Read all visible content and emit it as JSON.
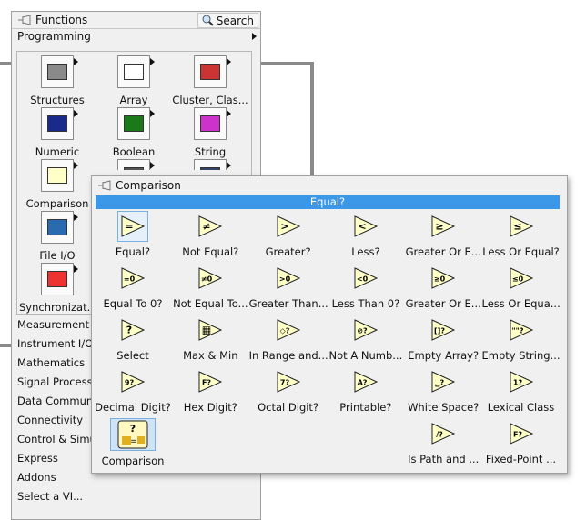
{
  "functions_palette": {
    "title": "Functions",
    "search_label": "Search",
    "programming_label": "Programming",
    "subpalettes": [
      {
        "label": "Structures",
        "icon": "structures-icon"
      },
      {
        "label": "Array",
        "icon": "array-icon"
      },
      {
        "label": "Cluster, Clas...",
        "icon": "cluster-icon"
      },
      {
        "label": "Numeric",
        "icon": "numeric-icon"
      },
      {
        "label": "Boolean",
        "icon": "boolean-icon"
      },
      {
        "label": "String",
        "icon": "string-icon"
      },
      {
        "label": "Comparison",
        "icon": "comparison-icon"
      },
      {
        "label": "",
        "icon": "timing-icon"
      },
      {
        "label": "",
        "icon": "dialog-icon"
      },
      {
        "label": "File I/O",
        "icon": "file-io-icon"
      },
      {
        "label": "",
        "icon": ""
      },
      {
        "label": "",
        "icon": ""
      },
      {
        "label": "Synchronizat...",
        "icon": "synchronization-icon"
      }
    ],
    "categories": [
      "Measurement I",
      "Instrument I/O",
      "Mathematics",
      "Signal Processi",
      "Data Communi",
      "Connectivity",
      "Control & Simu",
      "Express",
      "Addons",
      "Select a VI..."
    ]
  },
  "comparison_palette": {
    "title": "Comparison",
    "highlighted": "Equal?",
    "items": [
      {
        "label": "Equal?",
        "glyph": "="
      },
      {
        "label": "Not Equal?",
        "glyph": "≠"
      },
      {
        "label": "Greater?",
        "glyph": ">"
      },
      {
        "label": "Less?",
        "glyph": "<"
      },
      {
        "label": "Greater Or E...",
        "glyph": "≥"
      },
      {
        "label": "Less Or Equal?",
        "glyph": "≤"
      },
      {
        "label": "Equal To 0?",
        "glyph": "=0"
      },
      {
        "label": "Not Equal To...",
        "glyph": "≠0"
      },
      {
        "label": "Greater Than...",
        "glyph": ">0"
      },
      {
        "label": "Less Than 0?",
        "glyph": "<0"
      },
      {
        "label": "Greater Or E...",
        "glyph": "≥0"
      },
      {
        "label": "Less Or Equa...",
        "glyph": "≤0"
      },
      {
        "label": "Select",
        "glyph": "?"
      },
      {
        "label": "Max & Min",
        "glyph": "▦"
      },
      {
        "label": "In Range and...",
        "glyph": "◇?"
      },
      {
        "label": "Not A Numb...",
        "glyph": "⊘?"
      },
      {
        "label": "Empty Array?",
        "glyph": "[]?"
      },
      {
        "label": "Empty String...",
        "glyph": "\"\"?"
      },
      {
        "label": "Decimal Digit?",
        "glyph": "9?"
      },
      {
        "label": "Hex Digit?",
        "glyph": "F?"
      },
      {
        "label": "Octal Digit?",
        "glyph": "7?"
      },
      {
        "label": "Printable?",
        "glyph": "A?"
      },
      {
        "label": "White Space?",
        "glyph": "␣?"
      },
      {
        "label": "Lexical Class",
        "glyph": "1?"
      },
      {
        "label": "Comparison",
        "glyph": "?="
      },
      {
        "label": "",
        "glyph": ""
      },
      {
        "label": "",
        "glyph": ""
      },
      {
        "label": "",
        "glyph": ""
      },
      {
        "label": "Is Path and ...",
        "glyph": "/?"
      },
      {
        "label": "Fixed-Point ...",
        "glyph": "F?"
      }
    ]
  }
}
